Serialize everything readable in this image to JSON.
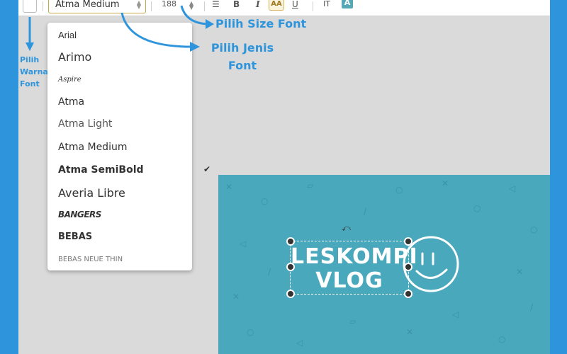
{
  "toolbar": {
    "font_value": "Atma Medium",
    "size_value": "188",
    "align_icon": "align-center-icon",
    "bold_label": "B",
    "italic_label": "I",
    "caps_label": "AA",
    "underline_label": "U",
    "spacing_label": "IT",
    "highlight_label": "A"
  },
  "dropdown": {
    "options": [
      {
        "label": "Arial"
      },
      {
        "label": "Arimo"
      },
      {
        "label": "Aspire"
      },
      {
        "label": "Atma"
      },
      {
        "label": "Atma Light"
      },
      {
        "label": "Atma Medium",
        "selected": true
      },
      {
        "label": "Atma SemiBold"
      },
      {
        "label": "Averia Libre"
      },
      {
        "label": "BANGERS"
      },
      {
        "label": "BEBAS"
      },
      {
        "label": "BEBAS NEUE THIN"
      }
    ],
    "check_mark": "✔"
  },
  "canvas": {
    "text_line1": "LESKOMPI",
    "text_line2": "VLOG",
    "background_color": "#4aa8bc"
  },
  "annotations": {
    "color_line1": "Pilih",
    "color_line2": "Warna",
    "color_line3": "Font",
    "size_label": "Pilih Size Font",
    "jenis_line1": "Pilih Jenis",
    "jenis_line2": "Font",
    "color": "#2e95dc"
  }
}
